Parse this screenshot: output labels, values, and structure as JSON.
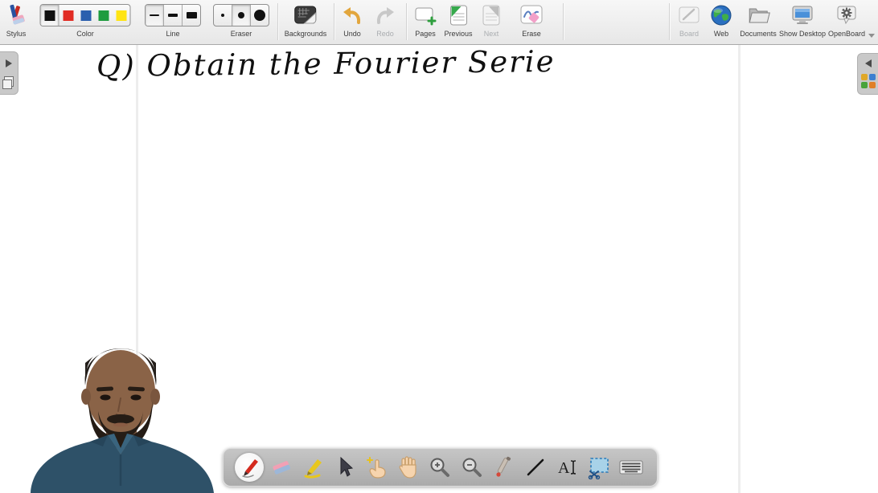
{
  "app": {
    "name": "OpenBoard"
  },
  "topbar": {
    "stylus": {
      "label": "Stylus"
    },
    "color": {
      "label": "Color",
      "swatches": [
        "#111111",
        "#e12c24",
        "#2a5fae",
        "#1f9c3f",
        "#ffe412"
      ],
      "selected_index": 0
    },
    "line": {
      "label": "Line"
    },
    "eraser": {
      "label": "Eraser"
    },
    "backgrounds": {
      "label": "Backgrounds"
    },
    "undo": {
      "label": "Undo",
      "enabled": true
    },
    "redo": {
      "label": "Redo",
      "enabled": false
    },
    "pages": {
      "label": "Pages"
    },
    "previous": {
      "label": "Previous",
      "enabled": true
    },
    "next": {
      "label": "Next",
      "enabled": false
    },
    "erase": {
      "label": "Erase"
    },
    "board": {
      "label": "Board",
      "enabled": false
    },
    "web": {
      "label": "Web"
    },
    "documents": {
      "label": "Documents"
    },
    "show_desktop": {
      "label": "Show Desktop"
    },
    "openboard": {
      "label": "OpenBoard"
    }
  },
  "canvas": {
    "handwriting": {
      "text": "Q) Obtain the Fourier Serie",
      "color": "#101010"
    },
    "page_edge_color": "#ededed"
  },
  "stylus_bar": {
    "selected_tool": "pen",
    "tools": [
      "pen",
      "eraser",
      "highlighter",
      "selector",
      "interact",
      "hand",
      "zoom-in",
      "zoom-out",
      "laser",
      "line",
      "text",
      "capture",
      "keyboard"
    ]
  }
}
